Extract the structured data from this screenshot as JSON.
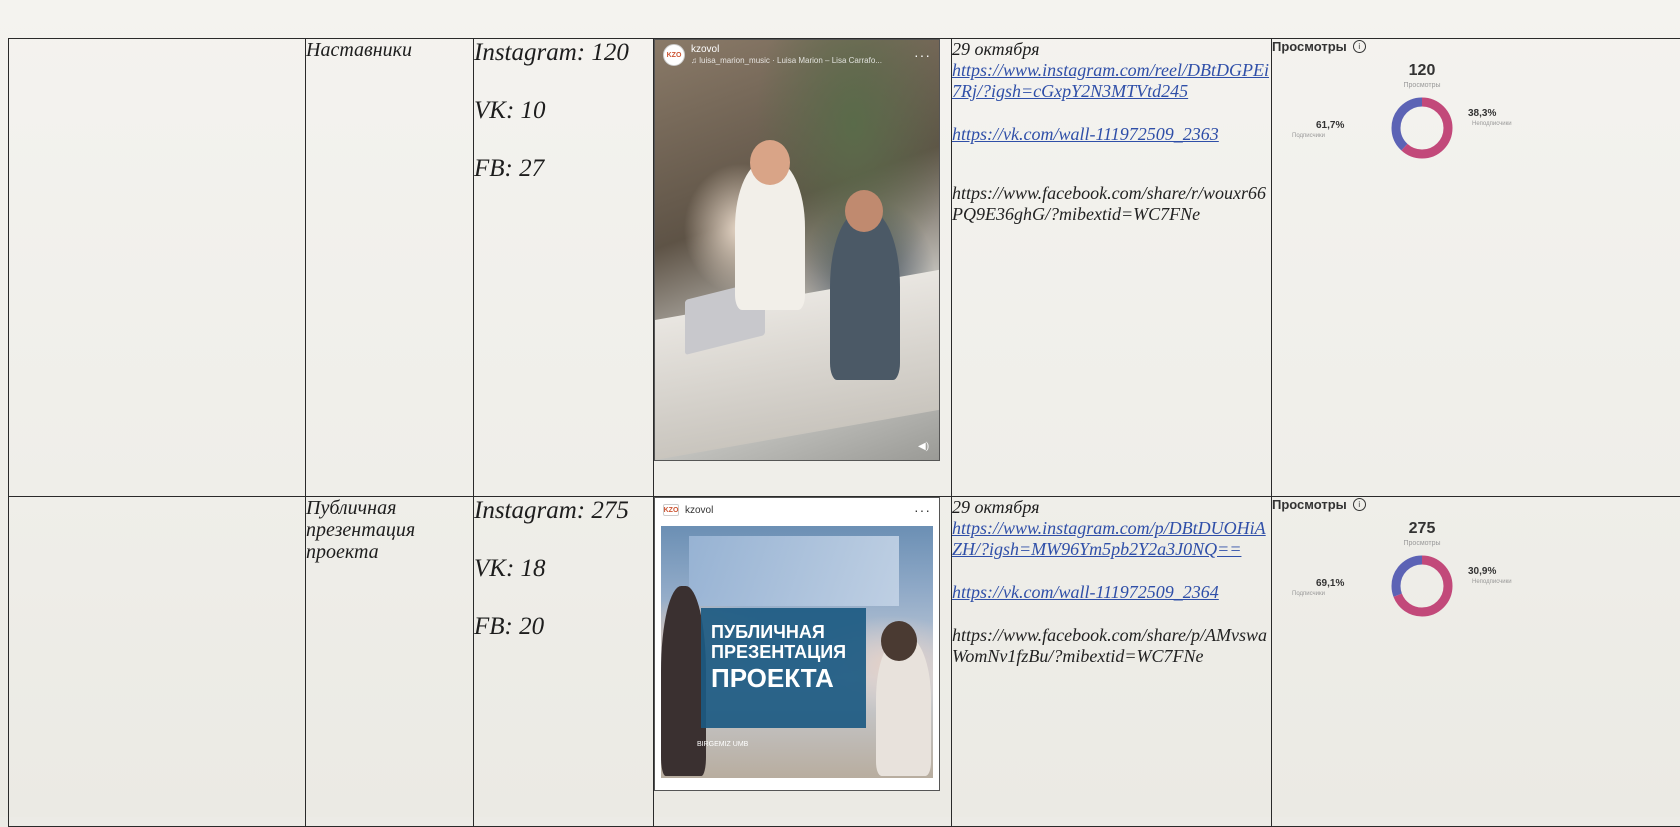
{
  "colors": {
    "followers": "#c2497a",
    "nonfollowers": "#5c63b5",
    "link": "#2f4fa8"
  },
  "rows": [
    {
      "topic": "Наставники",
      "stats": {
        "instagram": "Instagram: 120",
        "vk": "VK: 10",
        "fb": "FB: 27"
      },
      "post": {
        "account": "kzovol",
        "caption": "♫ luisa_marion_music · Luisa Marion – Lisa Carrafo...",
        "more": "···"
      },
      "date": "29 октября",
      "links": {
        "instagram": "https://www.instagram.com/reel/DBtDGPEi7Rj/?igsh=cGxpY2N3MTVtd245",
        "vk": "https://vk.com/wall-111972509_2363",
        "facebook": "https://www.facebook.com/share/r/wouxr66PQ9E36ghG/?mibextid=WC7FNe"
      },
      "views": {
        "title": "Просмотры",
        "total": "120",
        "total_label": "Просмотры",
        "followers_pct": "61,7%",
        "followers_label": "Подписчики",
        "nonfollowers_pct": "38,3%",
        "nonfollowers_label": "Неподписчики",
        "followers_share": 0.617
      }
    },
    {
      "topic": "Публичная презентация проекта",
      "stats": {
        "instagram": "Instagram: 275",
        "vk": "VK: 18",
        "fb": "FB: 20"
      },
      "post": {
        "account": "kzovol",
        "more": "···",
        "banner_line1": "ПУБЛИЧНАЯ",
        "banner_line2": "ПРЕЗЕНТАЦИЯ",
        "banner_line3": "ПРОЕКТА",
        "brand": "BIRGEMIZ UMB"
      },
      "date": "29 октября",
      "links": {
        "instagram": "https://www.instagram.com/p/DBtDUOHiAZH/?igsh=MW96Ym5pb2Y2a3J0NQ==",
        "vk": "https://vk.com/wall-111972509_2364",
        "facebook": "https://www.facebook.com/share/p/AMvswaWomNv1fzBu/?mibextid=WC7FNe"
      },
      "views": {
        "title": "Просмотры",
        "total": "275",
        "total_label": "Просмотры",
        "followers_pct": "69,1%",
        "followers_label": "Подписчики",
        "nonfollowers_pct": "30,9%",
        "nonfollowers_label": "Неподписчики",
        "followers_share": 0.691
      }
    }
  ]
}
